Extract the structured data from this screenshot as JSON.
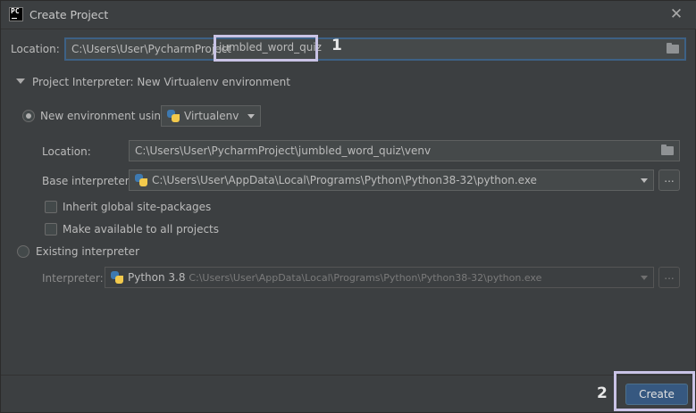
{
  "titlebar": {
    "app_icon_text": "PC",
    "title": "Create Project",
    "close_glyph": "✕"
  },
  "location": {
    "label": "Location:",
    "value_prefix": "C:\\Users\\User\\PycharmProject",
    "value_suffix": "jumbled_word_quiz",
    "annotation_number": "1"
  },
  "interpreter_section": {
    "title": "Project Interpreter: New Virtualenv environment"
  },
  "new_env": {
    "radio_label": "New environment using",
    "selected": true,
    "tool": "Virtualenv",
    "location_label": "Location:",
    "location_value": "C:\\Users\\User\\PycharmProject\\jumbled_word_quiz\\venv",
    "base_label": "Base interpreter:",
    "base_value": "C:\\Users\\User\\AppData\\Local\\Programs\\Python\\Python38-32\\python.exe",
    "browse_label": "...",
    "inherit_label": "Inherit global site-packages",
    "available_label": "Make available to all projects"
  },
  "existing": {
    "radio_label": "Existing interpreter",
    "interpreter_label": "Interpreter:",
    "interpreter_name": "Python 3.8",
    "interpreter_path": "C:\\Users\\User\\AppData\\Local\\Programs\\Python\\Python38-32\\python.exe",
    "browse_label": "..."
  },
  "footer": {
    "create_label": "Create",
    "annotation_number": "2"
  },
  "colors": {
    "background": "#3c3f41",
    "field": "#45494a",
    "primary_button": "#365880",
    "focus_border": "#3d6185",
    "annotation_box": "#c9c3e6"
  }
}
